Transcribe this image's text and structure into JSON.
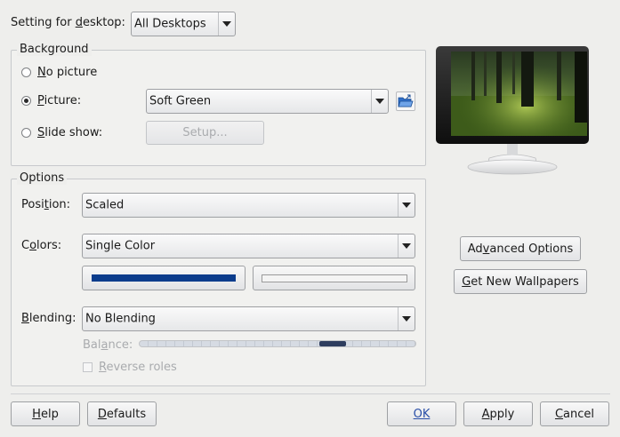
{
  "header": {
    "label_pre": "Setting for ",
    "label_u": "d",
    "label_post": "esktop:",
    "desktop_value": "All Desktops"
  },
  "background": {
    "title": "Background",
    "no_picture_u": "N",
    "no_picture_rest": "o picture",
    "picture_u": "P",
    "picture_rest": "icture:",
    "picture_value": "Soft Green",
    "slideshow_u": "S",
    "slideshow_rest": "lide show:",
    "setup_label": "Setup..."
  },
  "options": {
    "title": "Options",
    "position_pre": "Posi",
    "position_u": "t",
    "position_post": "ion:",
    "position_value": "Scaled",
    "colors_pre": "C",
    "colors_u": "o",
    "colors_post": "lors:",
    "colors_value": "Single Color",
    "blending_u": "B",
    "blending_rest": "lending:",
    "blending_value": "No Blending",
    "balance_pre": "Bal",
    "balance_u": "a",
    "balance_post": "nce:",
    "reverse_u": "R",
    "reverse_rest": "everse roles",
    "balance_level": 0.72
  },
  "colors": {
    "primary": "#0b3c8c",
    "secondary": "#f4f4f4"
  },
  "side": {
    "advanced_pre": "Ad",
    "advanced_u": "v",
    "advanced_post": "anced Options",
    "wallpapers_u": "G",
    "wallpapers_rest": "et New Wallpapers"
  },
  "footer": {
    "help_u": "H",
    "help_rest": "elp",
    "defaults_u": "D",
    "defaults_rest": "efaults",
    "ok_label": "OK",
    "apply_u": "A",
    "apply_rest": "pply",
    "cancel_u": "C",
    "cancel_rest": "ancel"
  }
}
